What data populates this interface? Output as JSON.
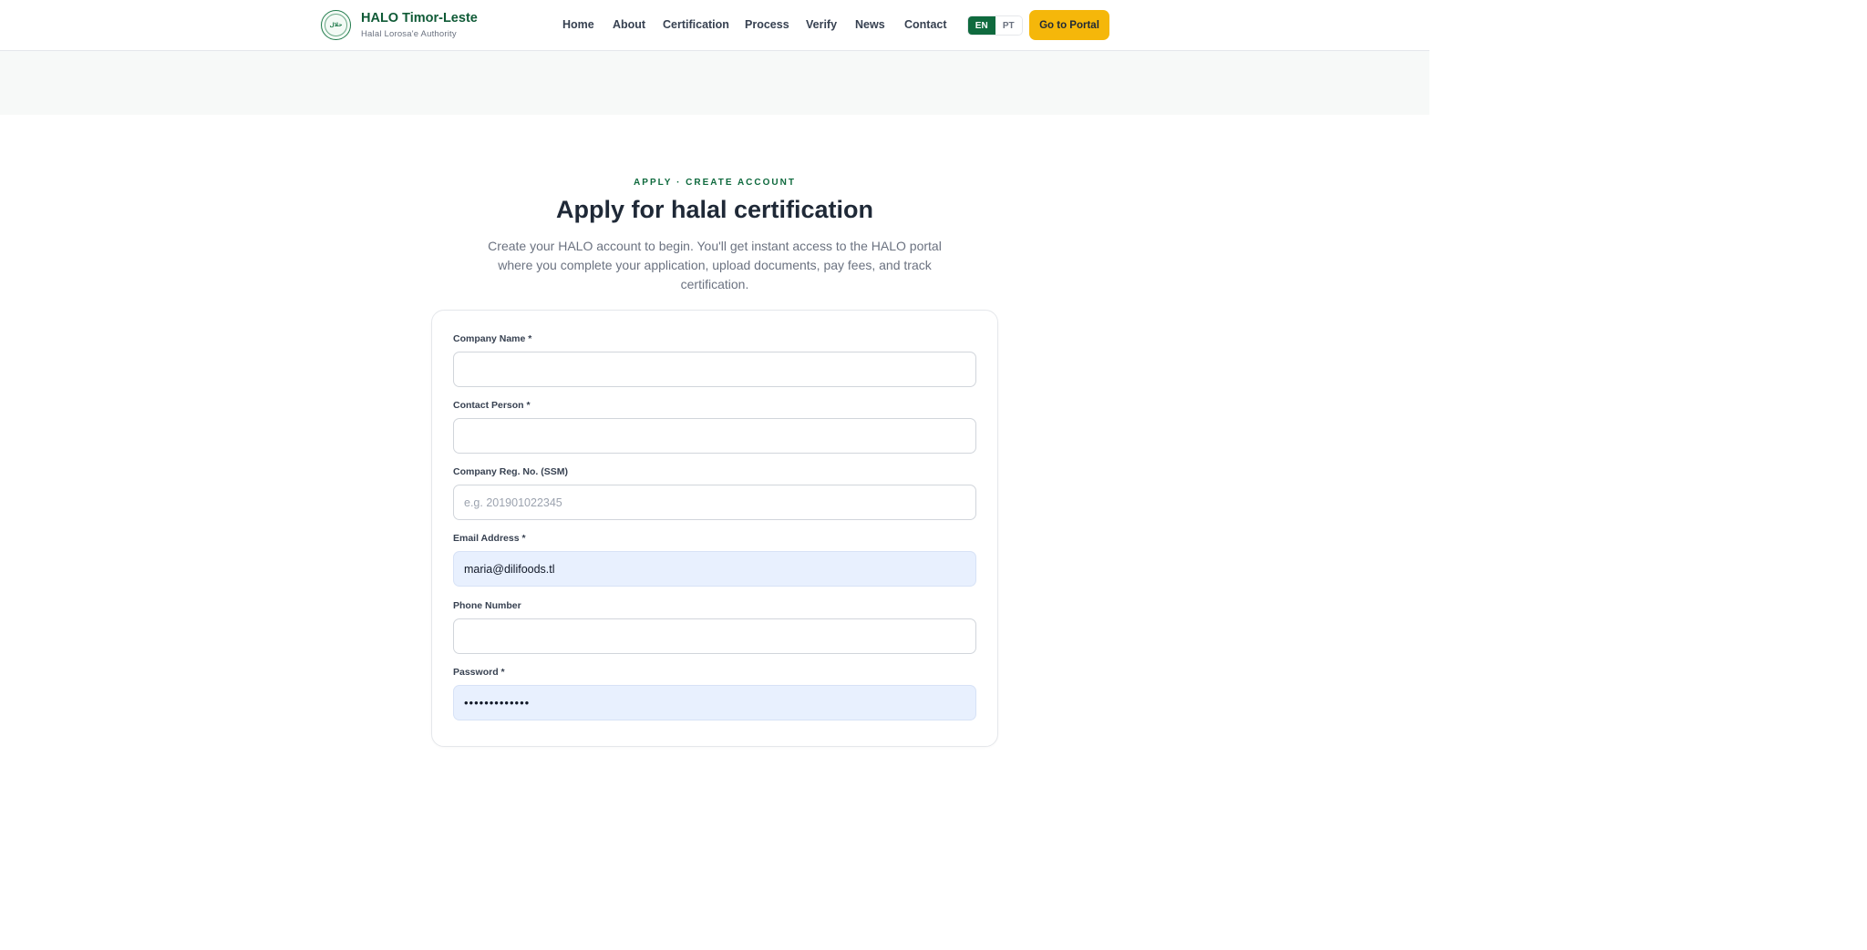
{
  "header": {
    "brand_title": "HALO Timor-Leste",
    "brand_subtitle": "Halal Lorosa'e Authority",
    "logo_text": "حلال",
    "nav": [
      "Home",
      "About",
      "Certification",
      "Process",
      "Verify",
      "News",
      "Contact"
    ],
    "lang": {
      "en": "EN",
      "pt": "PT",
      "active": "EN"
    },
    "portal_label": "Go to Portal"
  },
  "hero": {
    "kicker": "APPLY · CREATE ACCOUNT",
    "title": "Apply for halal certification",
    "lead": "Create your HALO account to begin. You'll get instant access to the HALO portal where you complete your application, upload documents, pay fees, and track certification."
  },
  "form": {
    "company_name": {
      "label": "Company Name *",
      "value": "",
      "placeholder": ""
    },
    "contact_person": {
      "label": "Contact Person *",
      "value": "",
      "placeholder": ""
    },
    "reg_no": {
      "label": "Company Reg. No. (SSM)",
      "value": "",
      "placeholder": "e.g. 201901022345"
    },
    "email": {
      "label": "Email Address *",
      "value": "maria@dilifoods.tl",
      "placeholder": ""
    },
    "phone": {
      "label": "Phone Number",
      "value": "",
      "placeholder": ""
    },
    "password": {
      "label": "Password *",
      "value": "•••••••••••••",
      "placeholder": ""
    }
  },
  "colors": {
    "brand_green": "#0f6a3e",
    "accent_yellow": "#f5b70a",
    "autofill_blue": "#e8f0fe"
  }
}
